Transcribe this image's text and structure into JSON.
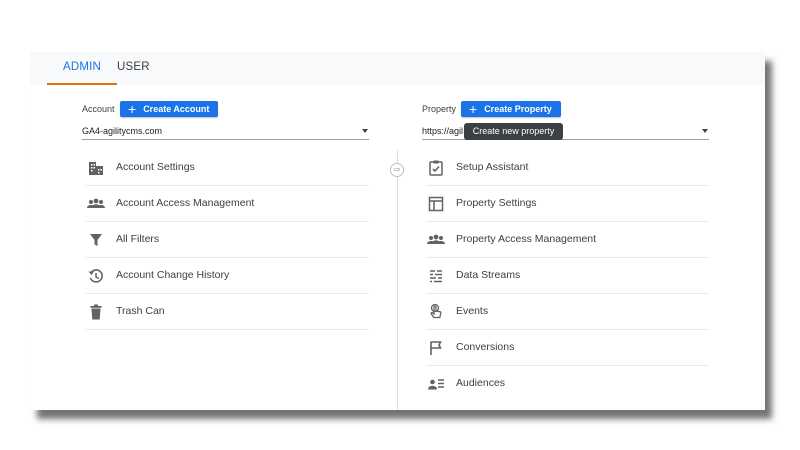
{
  "tabs": [
    {
      "label": "ADMIN",
      "active": true
    },
    {
      "label": "USER",
      "active": false
    }
  ],
  "account": {
    "label": "Account",
    "create_button": "Create Account",
    "selected": "GA4-agilitycms.com",
    "items": [
      {
        "label": "Account Settings",
        "icon": "building-icon"
      },
      {
        "label": "Account Access Management",
        "icon": "people-icon"
      },
      {
        "label": "All Filters",
        "icon": "filter-icon"
      },
      {
        "label": "Account Change History",
        "icon": "history-icon"
      },
      {
        "label": "Trash Can",
        "icon": "trash-icon"
      }
    ]
  },
  "property": {
    "label": "Property",
    "create_button": "Create Property",
    "selected": "https://agil",
    "tooltip": "Create new property",
    "items": [
      {
        "label": "Setup Assistant",
        "icon": "clipboard-check-icon"
      },
      {
        "label": "Property Settings",
        "icon": "layout-icon"
      },
      {
        "label": "Property Access Management",
        "icon": "people-icon"
      },
      {
        "label": "Data Streams",
        "icon": "data-streams-icon"
      },
      {
        "label": "Events",
        "icon": "touch-icon"
      },
      {
        "label": "Conversions",
        "icon": "flag-icon"
      },
      {
        "label": "Audiences",
        "icon": "audience-icon"
      }
    ]
  },
  "colors": {
    "accent_blue": "#1a73e8",
    "active_tab_underline": "#e37400",
    "tooltip_bg": "#3c4043"
  }
}
